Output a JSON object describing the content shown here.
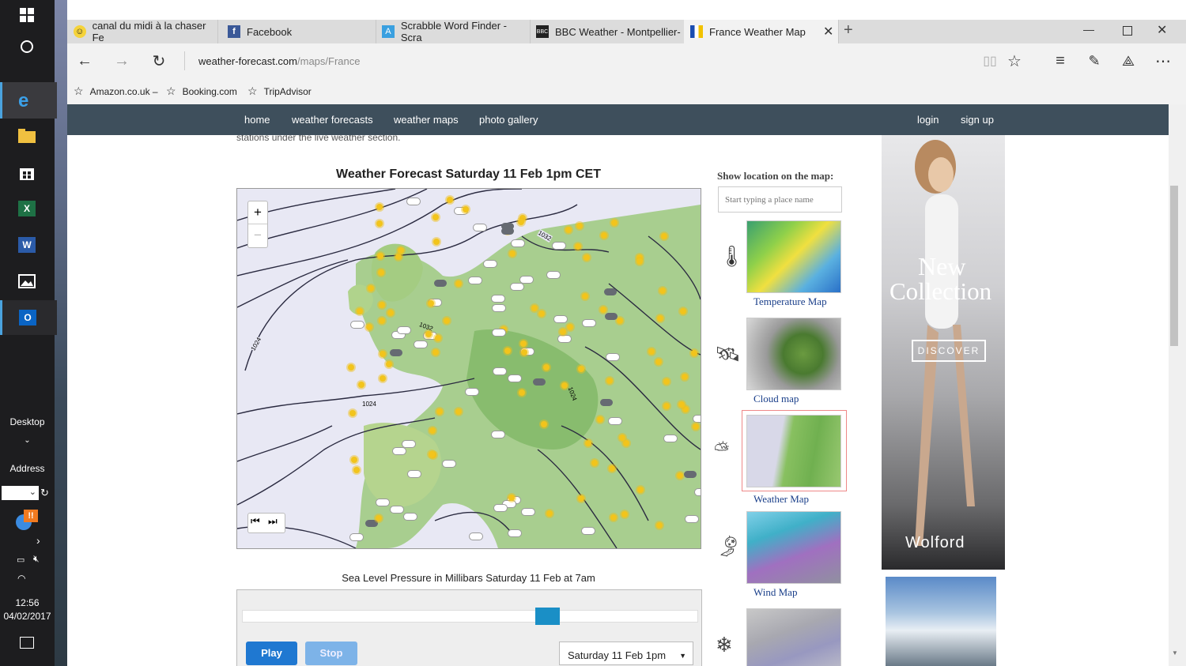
{
  "taskbar": {
    "desktop_label": "Desktop",
    "address_label": "Address",
    "time": "12:56",
    "date": "04/02/2017",
    "notification_badge": "!!"
  },
  "tabs": [
    {
      "label": "canal du midi à la chaser Fe",
      "icon": "smiley-icon"
    },
    {
      "label": "Facebook",
      "icon": "facebook-icon"
    },
    {
      "label": "Scrabble Word Finder - Scra",
      "icon": "scrabble-icon"
    },
    {
      "label": "BBC Weather - Montpellier-",
      "icon": "bbc-icon"
    },
    {
      "label": "France Weather Map",
      "icon": "weather-flag-icon"
    }
  ],
  "address": {
    "domain": "weather-forecast.com",
    "path": "/maps/France"
  },
  "favorites": [
    "Amazon.co.uk –",
    "Booking.com",
    "TripAdvisor"
  ],
  "site_nav": {
    "left": [
      "home",
      "weather forecasts",
      "weather maps",
      "photo gallery"
    ],
    "right": [
      "login",
      "sign up"
    ]
  },
  "content": {
    "intro_fragment": "stations under the live weather section.",
    "map_title": "Weather Forecast Saturday 11 Feb 1pm CET",
    "zoom_in": "+",
    "zoom_out": "−",
    "isobar_labels": [
      "1024",
      "1032",
      "1024",
      "1032",
      "1024"
    ],
    "caption": "Sea Level Pressure in Millibars Saturday 11 Feb at 7am",
    "play_label": "Play",
    "stop_label": "Stop",
    "time_select": "Saturday 11 Feb 1pm",
    "slider_position": 0.68,
    "show_location_label": "Show location on the map:",
    "location_placeholder": "Start typing a place name",
    "map_types": [
      {
        "label": "Temperature Map",
        "icon": "thermometer-icon"
      },
      {
        "label": "Cloud map",
        "icon": "satellite-icon"
      },
      {
        "label": "Weather Map",
        "icon": "weather-cloud-icon"
      },
      {
        "label": "Wind Map",
        "icon": "windsock-icon"
      },
      {
        "label": "",
        "icon": "snowflake-icon"
      }
    ]
  },
  "ad": {
    "headline_1": "New",
    "headline_2": "Collection",
    "button": "DISCOVER",
    "brand": "Wolford"
  },
  "colors": {
    "nav_bg": "#3e4f5c",
    "play_btn": "#1f78d1",
    "slider_handle": "#1a8fc6",
    "map_sea": "#e8e8f4",
    "map_land": "#8ec470"
  }
}
